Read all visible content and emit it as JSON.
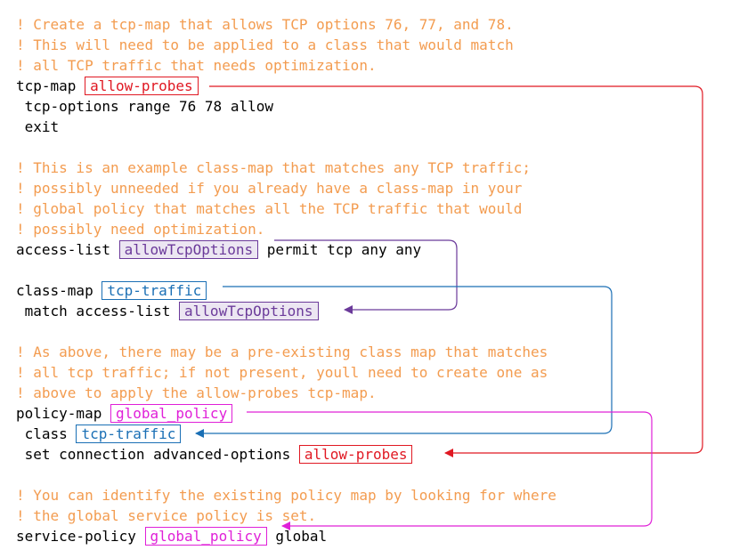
{
  "colors": {
    "comment": "#f39c50",
    "code": "#000000",
    "tcp_map_ref": "#e01822",
    "access_list_ref": "#6b3a9a",
    "class_map_ref": "#1a6fb5",
    "policy_map_ref": "#e020d8"
  },
  "comments": {
    "c1": "! Create a tcp-map that allows TCP options 76, 77, and 78.",
    "c2": "! This will need to be applied to a class that would match",
    "c3": "! all TCP traffic that needs optimization.",
    "c4": "! This is an example class-map that matches any TCP traffic;",
    "c5": "! possibly unneeded if you already have a class-map in your",
    "c6": "! global policy that matches all the TCP traffic that would",
    "c7": "! possibly need optimization.",
    "c8": "! As above, there may be a pre-existing class map that matches",
    "c9": "! all tcp traffic; if not present, youll need to create one as",
    "c10": "! above to apply the allow-probes tcp-map.",
    "c11": "! You can identify the existing policy map by looking for where",
    "c12": "! the global service policy is set."
  },
  "code": {
    "tcp_map_kw": "tcp-map ",
    "tcp_options": " tcp-options range 76 78 allow",
    "exit": " exit",
    "access_list_kw": "access-list ",
    "access_list_rest": " permit tcp any any",
    "class_map_kw": "class-map ",
    "match_kw": " match access-list ",
    "policy_map_kw": "policy-map ",
    "class_kw": " class ",
    "set_conn_kw": " set connection advanced-options ",
    "service_policy_kw": "service-policy ",
    "service_policy_rest": " global"
  },
  "names": {
    "tcp_map": "allow-probes",
    "access_list": "allowTcpOptions",
    "class_map": "tcp-traffic",
    "policy_map": "global_policy"
  }
}
